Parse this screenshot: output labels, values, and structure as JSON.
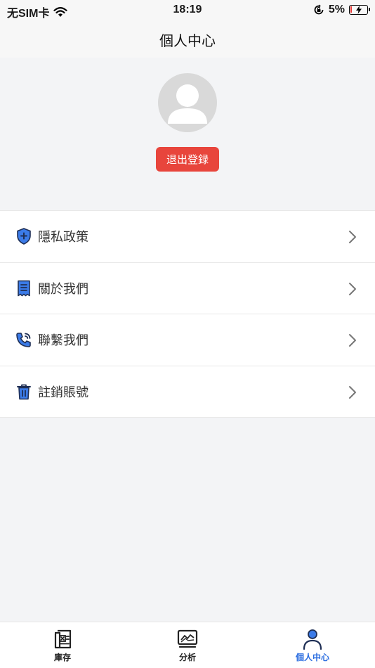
{
  "status_bar": {
    "carrier": "无SIM卡",
    "time": "18:19",
    "battery": "5%"
  },
  "header": {
    "title": "個人中心"
  },
  "profile": {
    "logout_label": "退出登録"
  },
  "menu": {
    "items": [
      {
        "label": "隱私政策",
        "icon": "shield-plus-icon"
      },
      {
        "label": "關於我們",
        "icon": "receipt-icon"
      },
      {
        "label": "聯繫我們",
        "icon": "phone-call-icon"
      },
      {
        "label": "註銷賬號",
        "icon": "trash-icon"
      }
    ]
  },
  "tab_bar": {
    "tabs": [
      {
        "label": "庫存",
        "icon": "inventory-icon"
      },
      {
        "label": "分析",
        "icon": "analysis-icon"
      },
      {
        "label": "個人中心",
        "icon": "user-icon"
      }
    ]
  },
  "colors": {
    "accent": "#2b6de0",
    "danger": "#e8453c",
    "icon_blue": "#3b7be8"
  }
}
